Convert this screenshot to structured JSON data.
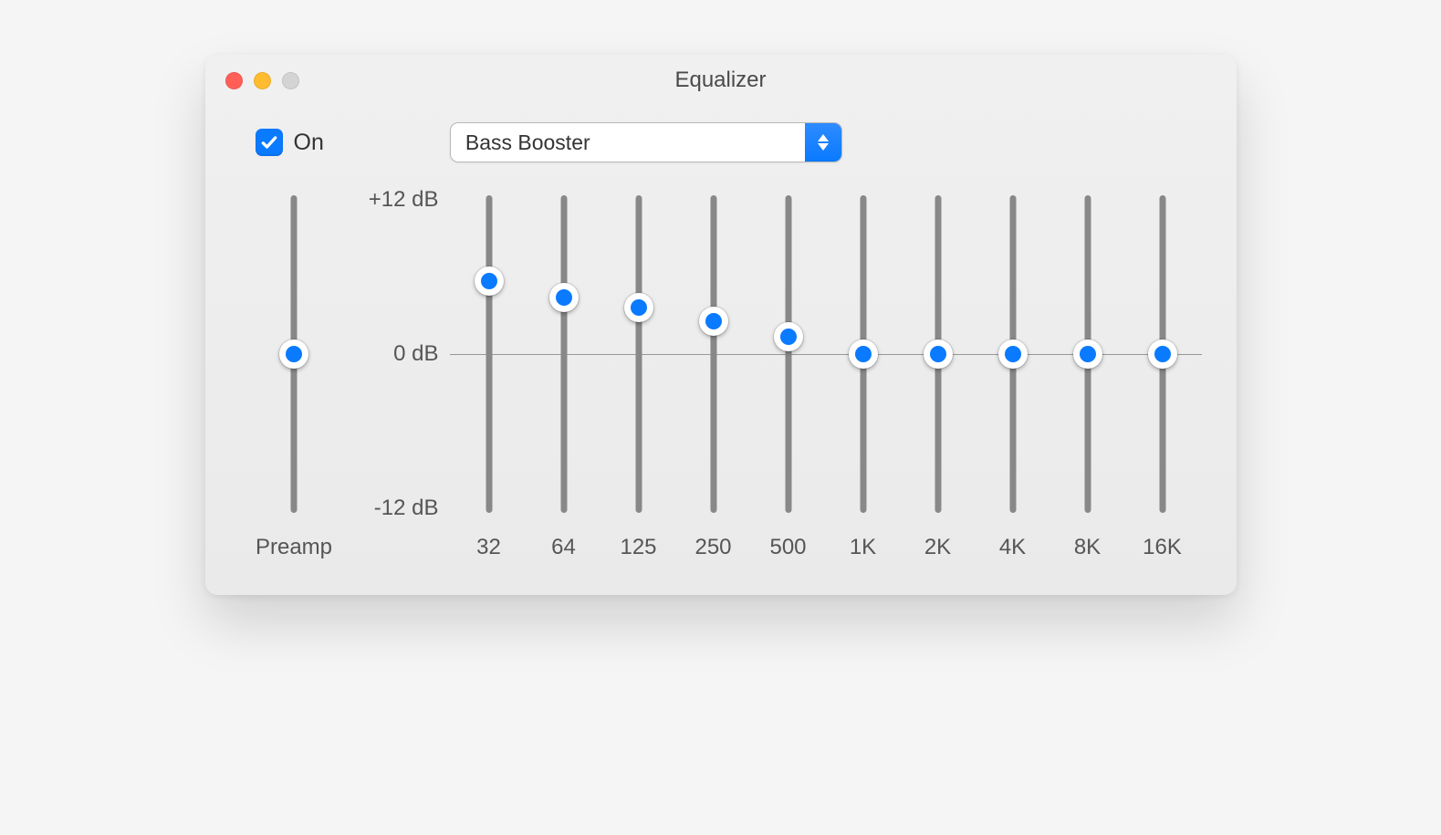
{
  "window": {
    "title": "Equalizer"
  },
  "controls": {
    "on_checked": true,
    "on_label": "On",
    "preset_selected": "Bass Booster"
  },
  "scale": {
    "max_label": "+12 dB",
    "mid_label": "0 dB",
    "min_label": "-12 dB",
    "max": 12,
    "min": -12
  },
  "preamp": {
    "label": "Preamp",
    "value": 0
  },
  "bands": [
    {
      "freq": "32",
      "value": 5.5
    },
    {
      "freq": "64",
      "value": 4.3
    },
    {
      "freq": "125",
      "value": 3.5
    },
    {
      "freq": "250",
      "value": 2.5
    },
    {
      "freq": "500",
      "value": 1.3
    },
    {
      "freq": "1K",
      "value": 0
    },
    {
      "freq": "2K",
      "value": 0
    },
    {
      "freq": "4K",
      "value": 0
    },
    {
      "freq": "8K",
      "value": 0
    },
    {
      "freq": "16K",
      "value": 0
    }
  ],
  "chart_data": {
    "type": "bar",
    "title": "Equalizer",
    "categories": [
      "32",
      "64",
      "125",
      "250",
      "500",
      "1K",
      "2K",
      "4K",
      "8K",
      "16K"
    ],
    "values": [
      5.5,
      4.3,
      3.5,
      2.5,
      1.3,
      0,
      0,
      0,
      0,
      0
    ],
    "ylabel": "dB",
    "ylim": [
      -12,
      12
    ]
  }
}
